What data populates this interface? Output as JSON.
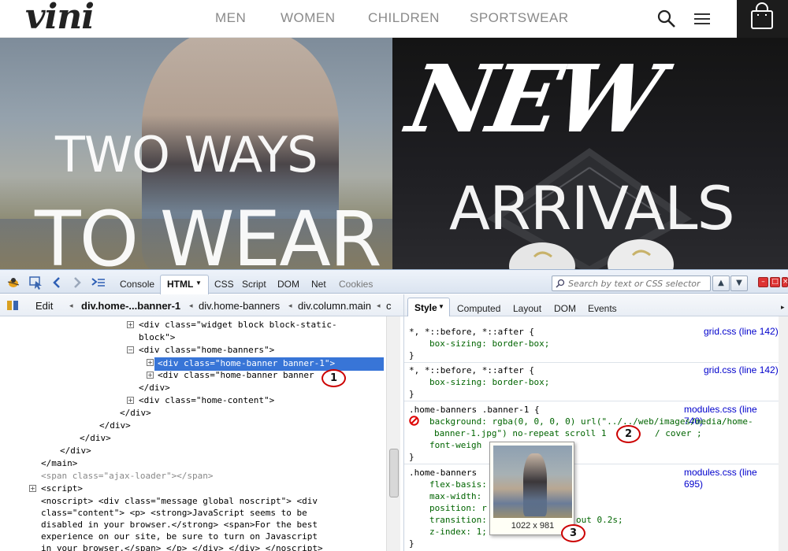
{
  "site": {
    "logo": "vini",
    "nav": [
      "MEN",
      "WOMEN",
      "CHILDREN",
      "SPORTSWEAR"
    ]
  },
  "banners": {
    "left": {
      "line1": "TWO WAYS",
      "line2": "TO WEAR"
    },
    "right": {
      "line1": "NEW",
      "line2": "ARRIVALS"
    }
  },
  "firebug": {
    "tabs": [
      "Console",
      "HTML",
      "CSS",
      "Script",
      "DOM",
      "Net",
      "Cookies"
    ],
    "search_placeholder": "Search by text or CSS selector",
    "edit_label": "Edit",
    "breadcrumbs": [
      "div.home-...banner-1",
      "div.home-banners",
      "div.column.main",
      "c"
    ],
    "side_tabs": [
      "Style",
      "Computed",
      "Layout",
      "DOM",
      "Events"
    ],
    "html_lines": [
      {
        "text": "<div class=\"widget block block-static-",
        "indent": 176
      },
      {
        "text": "block\">",
        "indent": 176
      },
      {
        "text": "<div class=\"home-banners\">",
        "indent": 176
      },
      {
        "text": "<div class=\"home-banner banner-1\">",
        "indent": 200
      },
      {
        "text": "<div class=\"home-banner banner",
        "indent": 200
      },
      {
        "text": "</div>",
        "indent": 176
      },
      {
        "text": "<div class=\"home-content\">",
        "indent": 176
      },
      {
        "text": "</div>",
        "indent": 152
      },
      {
        "text": "</div>",
        "indent": 126
      },
      {
        "text": "</div>",
        "indent": 101
      },
      {
        "text": "</div>",
        "indent": 76
      },
      {
        "text": "</main>",
        "indent": 52
      },
      {
        "text": "<span class=\"ajax-loader\"></span>",
        "indent": 52
      },
      {
        "text": "<script>",
        "indent": 52
      },
      {
        "text": "<noscript> <div class=\"message global noscript\"> <div",
        "indent": 52
      },
      {
        "text": "class=\"content\"> <p> <strong>JavaScript seems to be",
        "indent": 52
      },
      {
        "text": "disabled in your browser.</strong> <span>For the best",
        "indent": 52
      },
      {
        "text": "experience on our site, be sure to turn on Javascript",
        "indent": 52
      },
      {
        "text": "in your browser.</span> </p> </div> </div> </noscript>",
        "indent": 52
      }
    ],
    "style_rules": [
      {
        "selector": "*, *::before, *::after {",
        "source": "grid.css (line 142)",
        "props": [
          "box-sizing: border-box;"
        ]
      },
      {
        "selector": "*, *::before, *::after {",
        "source": "grid.css (line 142)",
        "props": [
          "box-sizing: border-box;"
        ]
      },
      {
        "selector": ".home-banners .banner-1 {",
        "source": "modules.css (line 740)",
        "props": [
          "background: rgba(0, 0, 0, 0) url(\"../../web/images/media/home-",
          "banner-1.jpg\") no-repeat scroll 1",
          "font-weigh"
        ]
      },
      {
        "selector": ".home-banners",
        "source": "modules.css (line 695)",
        "props": [
          "flex-basis:",
          "max-width:",
          "position: r",
          "transition:",
          "z-index: 1;"
        ]
      }
    ],
    "style_extra": {
      "cover": "/ cover ;",
      "transition_tail": "out 0.2s;"
    },
    "tooltip_dims": "1022 x 981"
  },
  "annotations": [
    "1",
    "2",
    "3"
  ],
  "colors": {
    "link": "#0000cc",
    "selection": "#3875d7",
    "annotation": "#cc0000"
  }
}
